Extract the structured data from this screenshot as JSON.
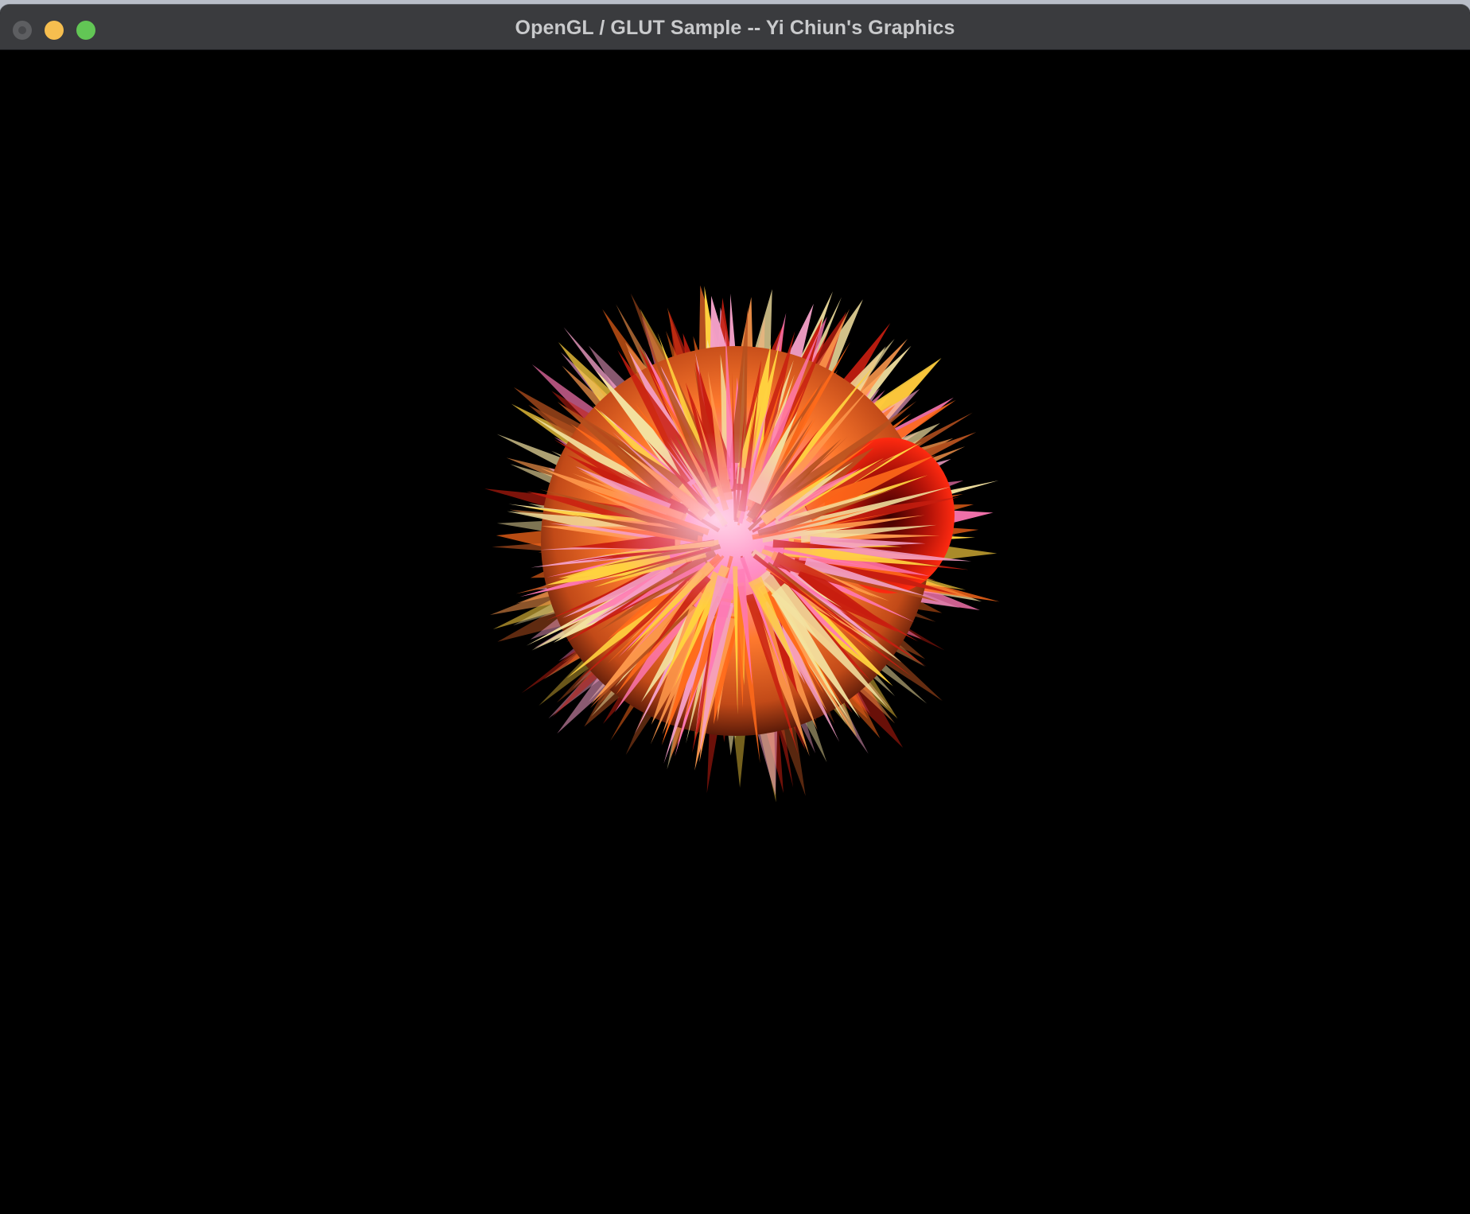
{
  "window": {
    "title": "OpenGL / GLUT Sample -- Yi Chiun's Graphics",
    "background_color": "#000000",
    "titlebar_color": "#3a3b3e"
  },
  "traffic_lights": {
    "close": {
      "icon": "close-icon",
      "color": "#5d5e61"
    },
    "minimize": {
      "icon": "minimize-icon",
      "color": "#f6be4f"
    },
    "zoom": {
      "icon": "zoom-icon",
      "color": "#62c655"
    }
  },
  "scene": {
    "object": "spiky-sphere",
    "palette": [
      "#ff6a1a",
      "#ffd23f",
      "#ff9a4d",
      "#f4a0c8",
      "#ff78b4",
      "#c81e10",
      "#f3e1a0",
      "#b4501e"
    ]
  }
}
